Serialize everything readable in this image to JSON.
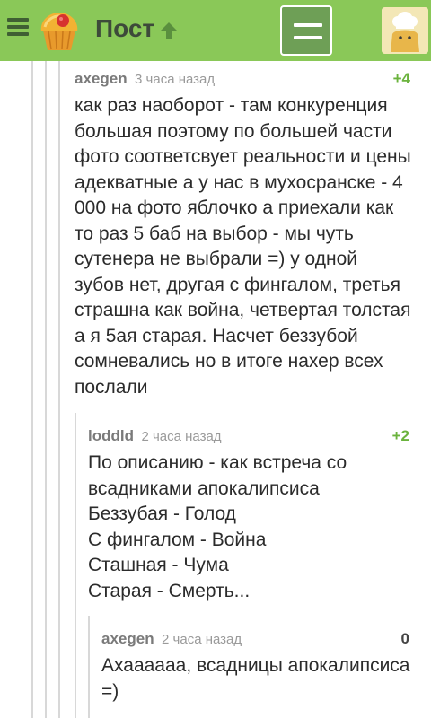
{
  "header": {
    "title": "Пост",
    "logo_icon": "cupcake-logo-icon",
    "colors": {
      "bar": "#8ac858",
      "title": "#3d4a3a"
    }
  },
  "comments": [
    {
      "author": "axegen",
      "time": "3 часа назад",
      "rating": "+4",
      "lines": [
        "как раз наоборот - там конкуренция",
        "большая поэтому по большей части",
        "фото соответсвует реальности и цены",
        "адекватные а у нас в мухосранске - 4",
        "000 на фото яблочко а приехали как",
        "то раз 5 баб на выбор - мы чуть",
        "сутенера не выбрали =) у одной",
        "зубов нет, другая с фингалом, третья",
        "страшна как война, четвертая толстая",
        "а я 5ая старая. Насчет беззубой",
        "сомневались но в итоге нахер всех",
        "послали"
      ]
    },
    {
      "author": "loddld",
      "time": "2 часа назад",
      "rating": "+2",
      "lines": [
        "По описанию - как встреча со",
        "всадниками апокалипсиса",
        "Беззубая - Голод",
        "С фингалом - Война",
        "Сташная - Чума",
        "Старая - Смерть..."
      ]
    },
    {
      "author": "axegen",
      "time": "2 часа назад",
      "rating": "0",
      "lines": [
        "Ахаааааа, всадницы апокалипсиса",
        "=)"
      ]
    }
  ]
}
